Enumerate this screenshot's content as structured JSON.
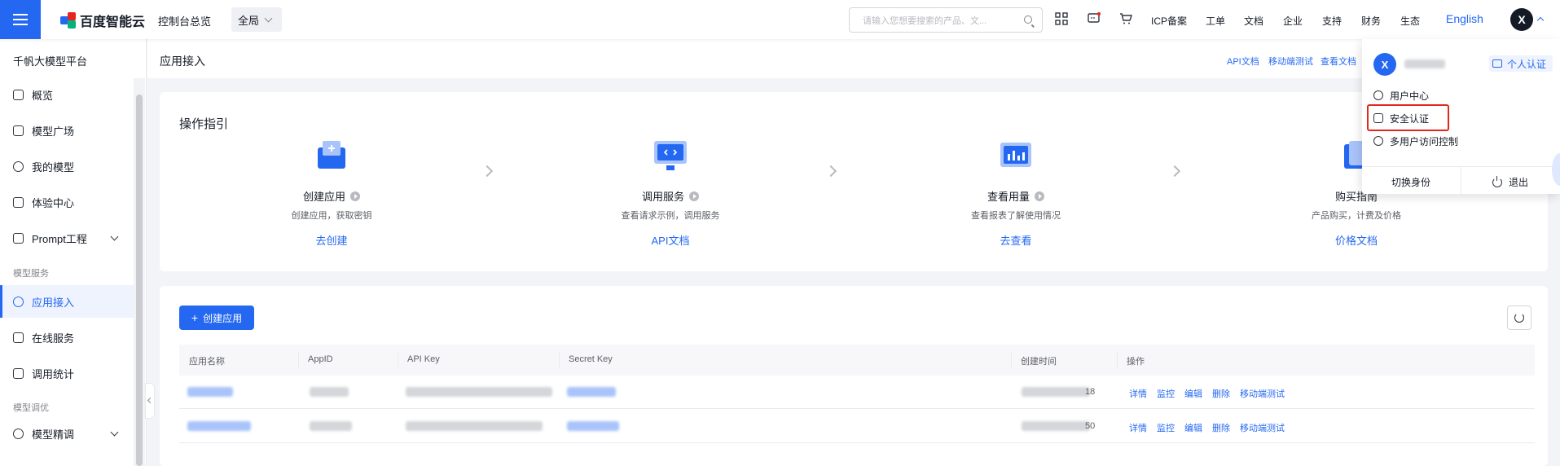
{
  "topbar": {
    "logo_text": "百度智能云",
    "console_overview": "控制台总览",
    "region": "全局",
    "search_placeholder": "请输入您想要搜索的产品、文...",
    "nav": [
      "ICP备案",
      "工单",
      "文档",
      "企业",
      "支持",
      "财务",
      "生态"
    ],
    "english": "English",
    "avatar_letter": "X",
    "icons": [
      "apps-icon",
      "message-icon",
      "cart-icon"
    ],
    "accent_color": "#2468f2"
  },
  "sidebar": {
    "title": "千帆大模型平台",
    "items_top": [
      {
        "label": "概览",
        "icon": "grid-icon"
      },
      {
        "label": "模型广场",
        "icon": "model-square-icon"
      },
      {
        "label": "我的模型",
        "icon": "my-model-icon"
      },
      {
        "label": "体验中心",
        "icon": "experience-icon"
      },
      {
        "label": "Prompt工程",
        "icon": "prompt-icon",
        "expandable": true
      }
    ],
    "group_service": "模型服务",
    "items_service": [
      {
        "label": "应用接入",
        "icon": "app-access-icon",
        "active": true
      },
      {
        "label": "在线服务",
        "icon": "online-service-icon"
      },
      {
        "label": "调用统计",
        "icon": "stats-icon"
      }
    ],
    "group_tuning": "模型调优",
    "items_tuning": [
      {
        "label": "模型精调",
        "icon": "fine-tune-icon",
        "expandable": true
      }
    ]
  },
  "header": {
    "title": "应用接入",
    "links": [
      "API文档",
      "移动端测试",
      "查看文档"
    ]
  },
  "guide": {
    "title": "操作指引",
    "steps": [
      {
        "name": "创建应用",
        "desc": "创建应用，获取密钥",
        "link": "去创建"
      },
      {
        "name": "调用服务",
        "desc": "查看请求示例，调用服务",
        "link": "API文档"
      },
      {
        "name": "查看用量",
        "desc": "查看报表了解使用情况",
        "link": "去查看"
      },
      {
        "name": "购买指南",
        "desc": "产品购买，计费及价格",
        "link": "价格文档"
      }
    ]
  },
  "table": {
    "create_button": "创建应用",
    "columns": [
      "应用名称",
      "AppID",
      "API Key",
      "Secret Key",
      "创建时间",
      "操作"
    ],
    "rows": [
      {
        "created_suffix": "18",
        "actions": [
          "详情",
          "监控",
          "编辑",
          "删除",
          "移动端测试"
        ]
      },
      {
        "created_suffix": "50",
        "actions": [
          "详情",
          "监控",
          "编辑",
          "删除",
          "移动端测试"
        ]
      }
    ]
  },
  "dropdown": {
    "avatar_letter": "X",
    "badge": "个人认证",
    "items": [
      {
        "label": "用户中心",
        "icon": "user-icon"
      },
      {
        "label": "安全认证",
        "icon": "shield-icon"
      },
      {
        "label": "多用户访问控制",
        "icon": "users-icon"
      }
    ],
    "switch_identity": "切换身份",
    "logout": "退出",
    "highlight_color": "#e3261e"
  }
}
